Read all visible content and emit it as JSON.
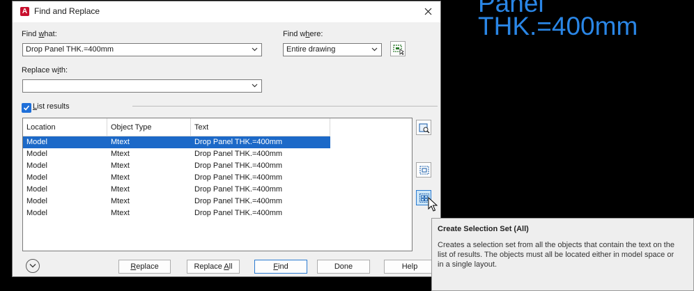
{
  "background": {
    "line1": "Panel",
    "line2": "THK.=400mm"
  },
  "dialog": {
    "title": "Find and Replace",
    "find_what": {
      "label_pre": "Find ",
      "label_u": "w",
      "label_post": "hat:",
      "value": "Drop Panel THK.=400mm"
    },
    "find_where": {
      "label_pre": "Find w",
      "label_u": "h",
      "label_post": "ere:",
      "value": "Entire drawing"
    },
    "replace_with": {
      "label_pre": "Replace w",
      "label_u": "i",
      "label_post": "th:",
      "value": ""
    },
    "list_results": {
      "label_u": "L",
      "label_post": "ist results",
      "checked": true
    },
    "results": {
      "columns": [
        "Location",
        "Object Type",
        "Text"
      ],
      "rows": [
        [
          "Model",
          "Mtext",
          "Drop Panel THK.=400mm"
        ],
        [
          "Model",
          "Mtext",
          "Drop Panel THK.=400mm"
        ],
        [
          "Model",
          "Mtext",
          "Drop Panel THK.=400mm"
        ],
        [
          "Model",
          "Mtext",
          "Drop Panel THK.=400mm"
        ],
        [
          "Model",
          "Mtext",
          "Drop Panel THK.=400mm"
        ],
        [
          "Model",
          "Mtext",
          "Drop Panel THK.=400mm"
        ],
        [
          "Model",
          "Mtext",
          "Drop Panel THK.=400mm"
        ]
      ]
    },
    "buttons": {
      "replace": {
        "pre": "",
        "u": "R",
        "post": "eplace"
      },
      "replace_all": {
        "pre": "Replace ",
        "u": "A",
        "post": "ll"
      },
      "find": {
        "pre": "",
        "u": "F",
        "post": "ind"
      },
      "done": {
        "pre": "",
        "u": "",
        "post": "Done"
      },
      "help": {
        "pre": "",
        "u": "",
        "post": "Help"
      }
    }
  },
  "tooltip": {
    "title": "Create Selection Set (All)",
    "body": "Creates a selection set from all the objects that contain the text on the list of results. The objects must all be located either in model space or in a single layout."
  },
  "colors": {
    "accent": "#1c69c8",
    "background_text": "#2a86e6",
    "app_icon": "#c8102e"
  }
}
